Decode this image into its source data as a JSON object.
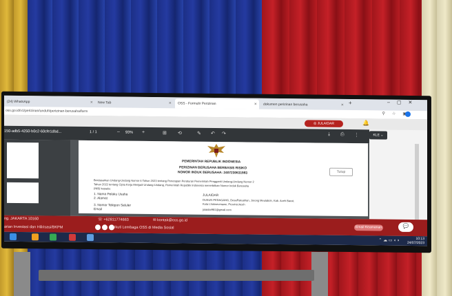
{
  "browser": {
    "tabs": [
      {
        "label": "(24) WhatsApp"
      },
      {
        "label": "New Tab"
      },
      {
        "label": "OSS - Formulir Perizinan"
      },
      {
        "label": "dokumen perizinan berusaha"
      }
    ],
    "address": "oss.go.id/v1/perizinan/unduh/perizinan-berusaha/form"
  },
  "site": {
    "user_label": "JULAIDAR"
  },
  "pdf_toolbar": {
    "file_name": "150-adb5-4250-b0c2-60cfe1dbd...",
    "page_indicator": "1 / 1",
    "zoom": "93%"
  },
  "select_label": "KLE",
  "document": {
    "heading": "PEMERINTAH REPUBLIK INDONESIA",
    "title_line1": "PERIZINAN BERUSAHA BERBASIS RISIKO",
    "title_line2": "NOMOR INDUK BERUSAHA: 2407230631983",
    "paragraph_line1": "Berdasarkan Undang-Undang Nomor 6 Tahun 2023 tentang Penetapan Peraturan Pemerintah Pengganti Undang-Undang Nomor 2",
    "paragraph_line2": "Tahun 2022 tentang Cipta Kerja Menjadi Undang-Undang, Pemerintah Republik Indonesia menerbitkan Nomor Induk Berusaha",
    "paragraph_line3": "(NIB) kepada:",
    "fields": [
      {
        "label": "1. Nama Pelaku Usaha",
        "value": "JULAIDAR"
      },
      {
        "label": "2. Alamat",
        "value": "DUSUN PEDAGANG, DesaPakuahan, Jorong Meulaboh, Kab. Aceh Barat,"
      },
      {
        "label": "",
        "value": "Kota Lhokseumawe, Provinsi Aceh"
      },
      {
        "label": "3. Nomor Telepon Seluler",
        "value": ""
      },
      {
        "label": "   Email",
        "value": "julaidar981@gmail.com"
      }
    ],
    "button_label": "Tutup"
  },
  "footer": {
    "phone": "+62811774663",
    "email": "kontak@oss.go.id",
    "left_text": "ng. JAKARTA 10160",
    "social_caption": "Ikuti Lembaga OSS di Media Sosial",
    "left_text2": "arian Investasi dan Hilirisasi/BKPM",
    "report_label": "Email Keamanan"
  },
  "taskbar": {
    "time": "10:13",
    "date": "24/07/2023"
  },
  "colors": {
    "footer_red": "#9b1d1d",
    "pdf_toolbar": "#323639",
    "user_button": "#b5231f"
  }
}
